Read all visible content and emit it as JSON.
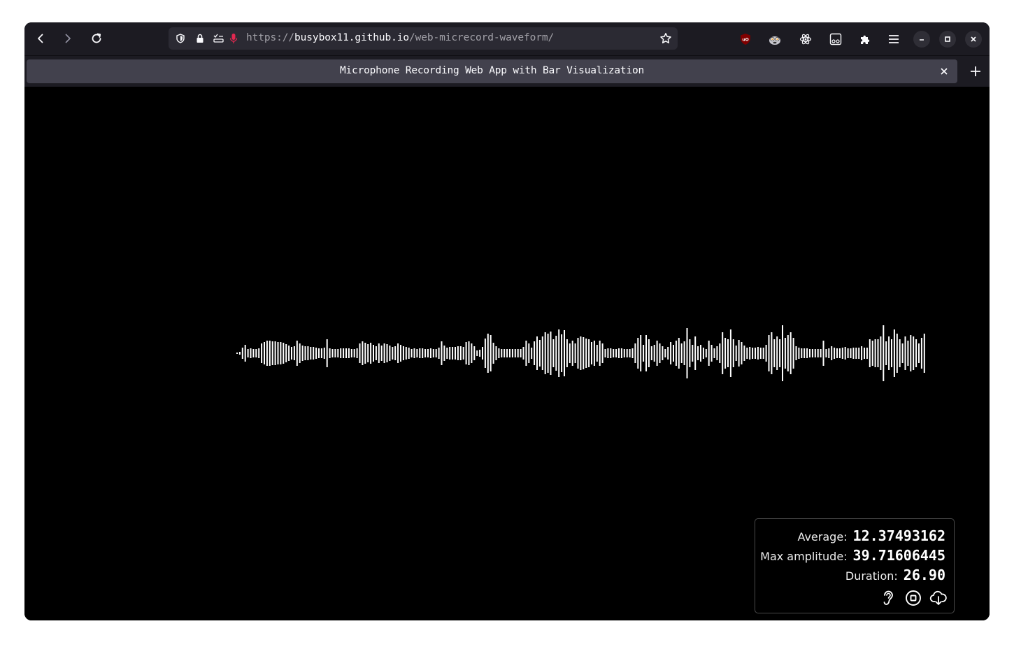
{
  "browser": {
    "url_scheme": "https://",
    "url_host": "busybox11.github.io",
    "url_path": "/web-micrecord-waveform/",
    "tab_title": "Microphone Recording Web App with Bar Visualization",
    "extensions": [
      "ublock-origin-icon",
      "privacy-badger-icon",
      "react-devtools-icon",
      "container-icon",
      "puzzle-extensions-icon"
    ]
  },
  "stats": {
    "average_label": "Average:",
    "average_value": "12.37493162",
    "max_label": "Max amplitude:",
    "max_value": "39.71606445",
    "duration_label": "Duration:",
    "duration_value": "26.90"
  },
  "actions": [
    "listen-icon",
    "stop-icon",
    "download-icon"
  ],
  "waveform": {
    "color": "#ffffff",
    "background": "#000000",
    "amplitudes": [
      1,
      2,
      8,
      12,
      6,
      7,
      6,
      6,
      7,
      14,
      16,
      18,
      18,
      17,
      17,
      16,
      16,
      15,
      13,
      11,
      9,
      10,
      18,
      14,
      11,
      10,
      10,
      9,
      9,
      8,
      7,
      7,
      8,
      20,
      7,
      6,
      6,
      6,
      7,
      7,
      7,
      7,
      6,
      6,
      7,
      14,
      17,
      15,
      13,
      15,
      12,
      10,
      14,
      11,
      14,
      13,
      11,
      9,
      10,
      14,
      12,
      10,
      9,
      8,
      6,
      7,
      6,
      7,
      7,
      6,
      6,
      7,
      6,
      6,
      8,
      17,
      11,
      8,
      9,
      9,
      9,
      10,
      10,
      9,
      16,
      17,
      14,
      10,
      4,
      5,
      9,
      21,
      28,
      26,
      15,
      10,
      7,
      6,
      6,
      6,
      6,
      6,
      6,
      6,
      6,
      9,
      18,
      14,
      8,
      17,
      24,
      19,
      24,
      30,
      28,
      31,
      20,
      25,
      34,
      27,
      33,
      20,
      14,
      18,
      14,
      22,
      24,
      23,
      21,
      20,
      16,
      18,
      12,
      18,
      14,
      6,
      7,
      7,
      6,
      6,
      7,
      7,
      6,
      6,
      6,
      7,
      14,
      22,
      26,
      12,
      26,
      20,
      10,
      12,
      18,
      14,
      10,
      6,
      9,
      16,
      12,
      18,
      22,
      14,
      17,
      36,
      20,
      12,
      24,
      10,
      12,
      8,
      6,
      18,
      12,
      7,
      10,
      14,
      30,
      22,
      20,
      34,
      20,
      11,
      19,
      16,
      11,
      8,
      9,
      8,
      8,
      9,
      8,
      8,
      12,
      26,
      30,
      20,
      24,
      20,
      40,
      22,
      26,
      30,
      22,
      10,
      8,
      7,
      7,
      7,
      6,
      6,
      6,
      6,
      6,
      18,
      6,
      7,
      10,
      8,
      7,
      7,
      8,
      9,
      7,
      7,
      8,
      8,
      8,
      10,
      8,
      8,
      20,
      18,
      20,
      20,
      24,
      40,
      17,
      24,
      20,
      34,
      28,
      20,
      14,
      24,
      18,
      26,
      24,
      20,
      14,
      22,
      28
    ]
  }
}
